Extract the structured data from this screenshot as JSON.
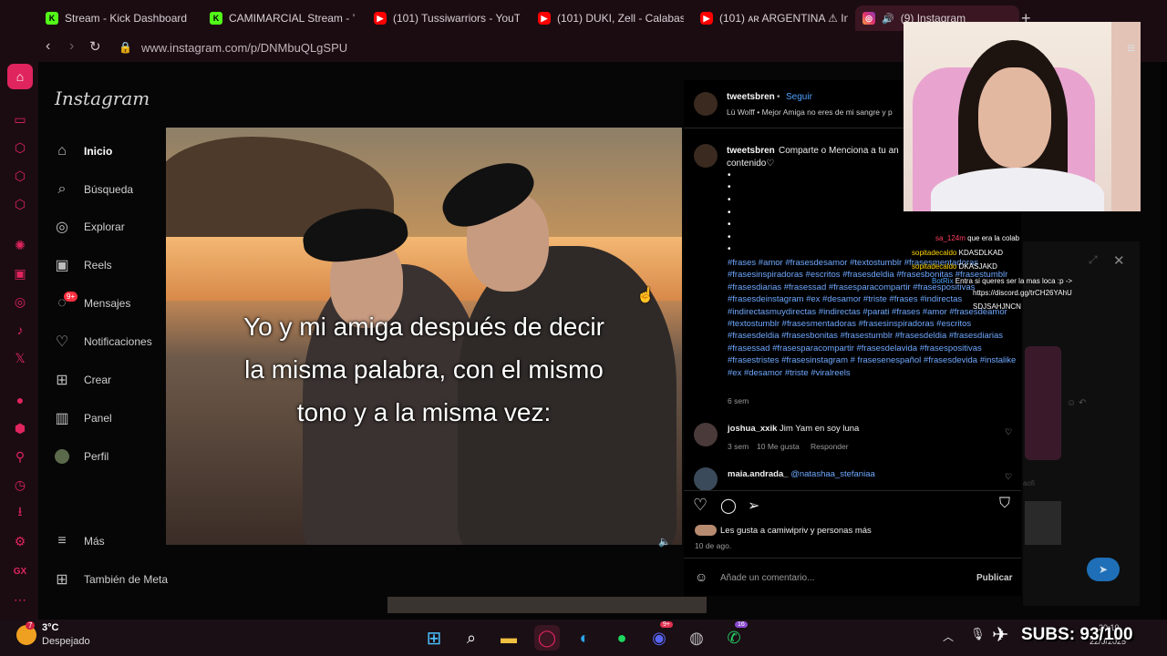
{
  "browser": {
    "tabs": [
      {
        "label": "Stream - Kick Dashboard",
        "icon": "kick-icon"
      },
      {
        "label": "CAMIMARCIAL Stream - ’",
        "icon": "kick-icon"
      },
      {
        "label": "(101) Tussiwarriors - YouT",
        "icon": "youtube-icon"
      },
      {
        "label": "(101) DUKI, Zell - Calabas",
        "icon": "youtube-icon"
      },
      {
        "label": "(101) ᴀʀ ARGENTINA ⚠ In",
        "icon": "youtube-icon"
      },
      {
        "label": "(9) Instagram",
        "icon": "instagram-icon"
      }
    ],
    "url": "www.instagram.com/p/DNMbuQLgSPU",
    "new_tab": "+"
  },
  "instagram": {
    "logo": "Instagram",
    "nav": [
      {
        "label": "Inicio",
        "icon": "home-icon"
      },
      {
        "label": "Búsqueda",
        "icon": "search-icon"
      },
      {
        "label": "Explorar",
        "icon": "compass-icon"
      },
      {
        "label": "Reels",
        "icon": "reels-icon"
      },
      {
        "label": "Mensajes",
        "icon": "messenger-icon"
      },
      {
        "label": "Notificaciones",
        "icon": "heart-icon"
      },
      {
        "label": "Crear",
        "icon": "plus-icon"
      },
      {
        "label": "Panel",
        "icon": "chart-icon"
      },
      {
        "label": "Perfil",
        "icon": "avatar-icon"
      }
    ],
    "messages_badge": "9+",
    "more": "Más",
    "also_meta": "También de Meta",
    "post": {
      "caption_lines": [
        "Yo y mi amiga después de decir",
        "la misma palabra, con el mismo",
        "tono y a la misma vez:"
      ]
    },
    "panel": {
      "author": "tweetsbren",
      "follow": "Seguir",
      "audio": "Lü Wolff • Mejor Amiga no eres de mi sangre y p",
      "desc_user": "tweetsbren",
      "desc_text": "Comparte o Menciona a tu an",
      "desc_text2": "contenido♡",
      "bullets": [
        "•",
        "•",
        "•",
        "•",
        "•",
        "•",
        "•"
      ],
      "hashtags": "#frases #amor #frasesdesamor #textostumblr #frasesmentadoras #frasesinspiradoras #escritos #frasesdeldia #frasesbonitas #frasestumblr #frasesdiarias #frasessad #frasesparacompartir #frasespositivas #frasesdeinstagram #ex #desamor #triste #frases #indirectas #indirectasmuydirectas #indirectas #parati #frases #amor #frasesdeamor #textostumblr #frasesmentadoras #frasesinspiradoras #escritos #frasesdeldia #frasesbonitas #frasestumblr #frasesdeldia #frasesdiarias #frasessad #frasesparacompartir #frasesdelavida #frasespositivas #frasestristes #frasesinstagram # frasesenespañol #frasesdevida #instalike #ex #desamor #triste #viralreels",
      "desc_time": "6 sem",
      "comments": [
        {
          "user": "joshua_xxik",
          "text": "Jim Yam en soy luna",
          "time": "3 sem",
          "likes": "10 Me gusta",
          "reply": "Responder"
        },
        {
          "user": "maia.andrada_",
          "mention": "@natashaa_stefaniaa"
        }
      ],
      "likes_text": "Les gusta a camiwipriv y personas más",
      "date": "10 de ago.",
      "comment_placeholder": "Añade un comentario...",
      "publish": "Publicar"
    }
  },
  "chat": [
    {
      "user": "sa_124m",
      "msg": "que era la colab"
    },
    {
      "user": "sopitadecaldo",
      "msg": "KDASDLKAD"
    },
    {
      "user": "sopitadecaldo",
      "msg": "DKASJAKD"
    },
    {
      "user": "BotRix",
      "msg": "Entra si queres ser la mas loca :p ->"
    },
    {
      "user": "",
      "msg": "https://discord.gg/trCH26YAhU"
    },
    {
      "user": "",
      "msg": "SDJSAHJNCN"
    }
  ],
  "taskbar": {
    "weather_temp": "3°C",
    "weather_desc": "Despejado",
    "weather_badge": "7",
    "discord_badge": "9+",
    "whatsapp_badge": "16",
    "clock_time": "20:10",
    "clock_date": "22/9/2025",
    "subs": "SUBS: 93/100"
  },
  "colors": {
    "opera_red": "#e0245e",
    "instagram_link": "#4aa3ff",
    "hashtag": "#6ea8ff"
  }
}
